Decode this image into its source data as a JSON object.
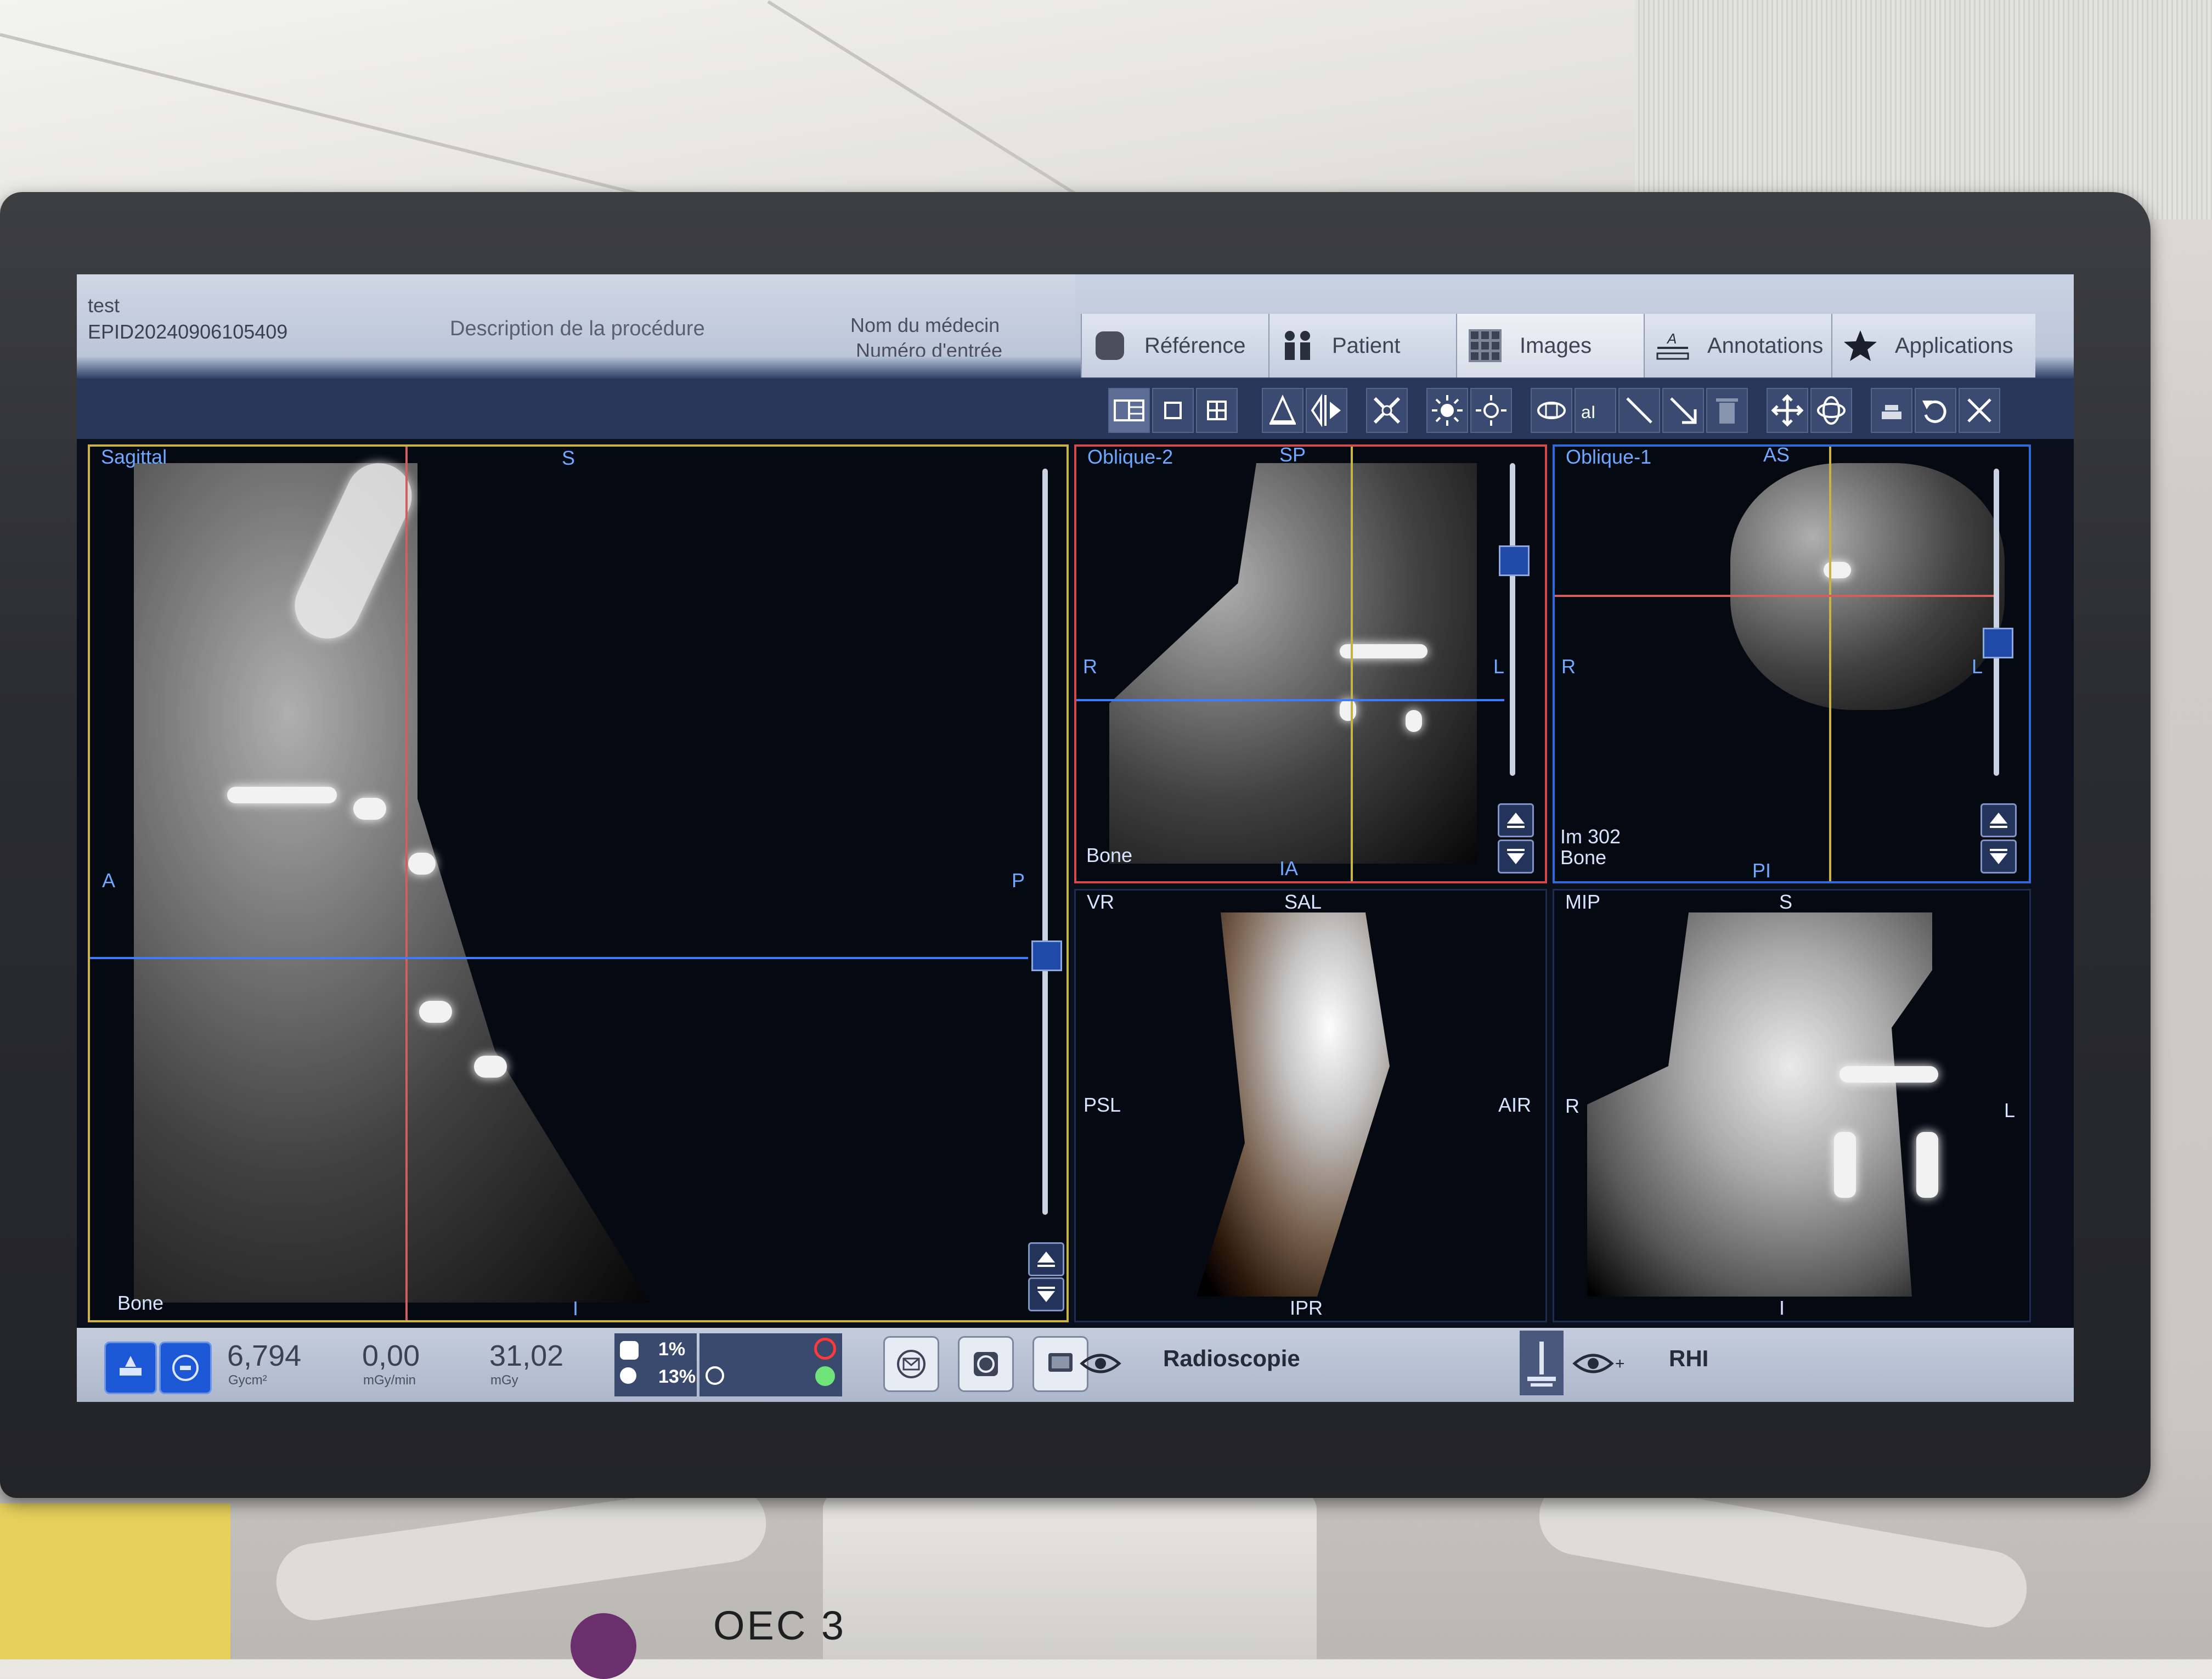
{
  "header": {
    "patient_name": "test",
    "patient_id": "EPID20240906105409",
    "procedure_description": "Description de la procédure",
    "physician_name": "Nom du médecin",
    "entry_number": "Numéro d'entrée"
  },
  "tabs": [
    {
      "label": "Référence",
      "icon": "reference-icon"
    },
    {
      "label": "Patient",
      "icon": "patient-icon"
    },
    {
      "label": "Images",
      "icon": "images-grid-icon"
    },
    {
      "label": "Annotations",
      "icon": "annotations-icon"
    },
    {
      "label": "Applications",
      "icon": "star-icon"
    }
  ],
  "viewports": {
    "sagittal": {
      "title": "Sagittal",
      "top": "S",
      "bottom": "I",
      "left": "A",
      "right": "P",
      "preset": "Bone"
    },
    "oblique2": {
      "title": "Oblique-2",
      "top": "SP",
      "bottom": "IA",
      "left": "R",
      "right": "L",
      "preset": "Bone"
    },
    "oblique1": {
      "title": "Oblique-1",
      "top": "AS",
      "bottom": "PI",
      "left": "R",
      "right": "L",
      "image_number": "Im 302",
      "preset": "Bone"
    },
    "vr": {
      "title": "VR",
      "top": "SAL",
      "bottom": "IPR",
      "left": "PSL",
      "right": "AIR"
    },
    "mip": {
      "title": "MIP",
      "top": "S",
      "bottom": "I",
      "left": "R",
      "right": "L"
    }
  },
  "status": {
    "dap_value": "6,794",
    "dap_unit": "Gycm²",
    "rate_value": "0,00",
    "rate_unit": "mGy/min",
    "dose_value": "31,02",
    "dose_unit": "mGy",
    "pct_top": "1%",
    "pct_bottom": "13%",
    "mode_label": "Radioscopie",
    "secondary_label": "RHI"
  },
  "colors": {
    "accent_blue": "#3d7bff",
    "crosshair_red": "#d25e5e",
    "sagittal_border": "#c8b24a",
    "oblique2_border": "#d24a4a",
    "oblique1_border": "#2f6ad6"
  }
}
